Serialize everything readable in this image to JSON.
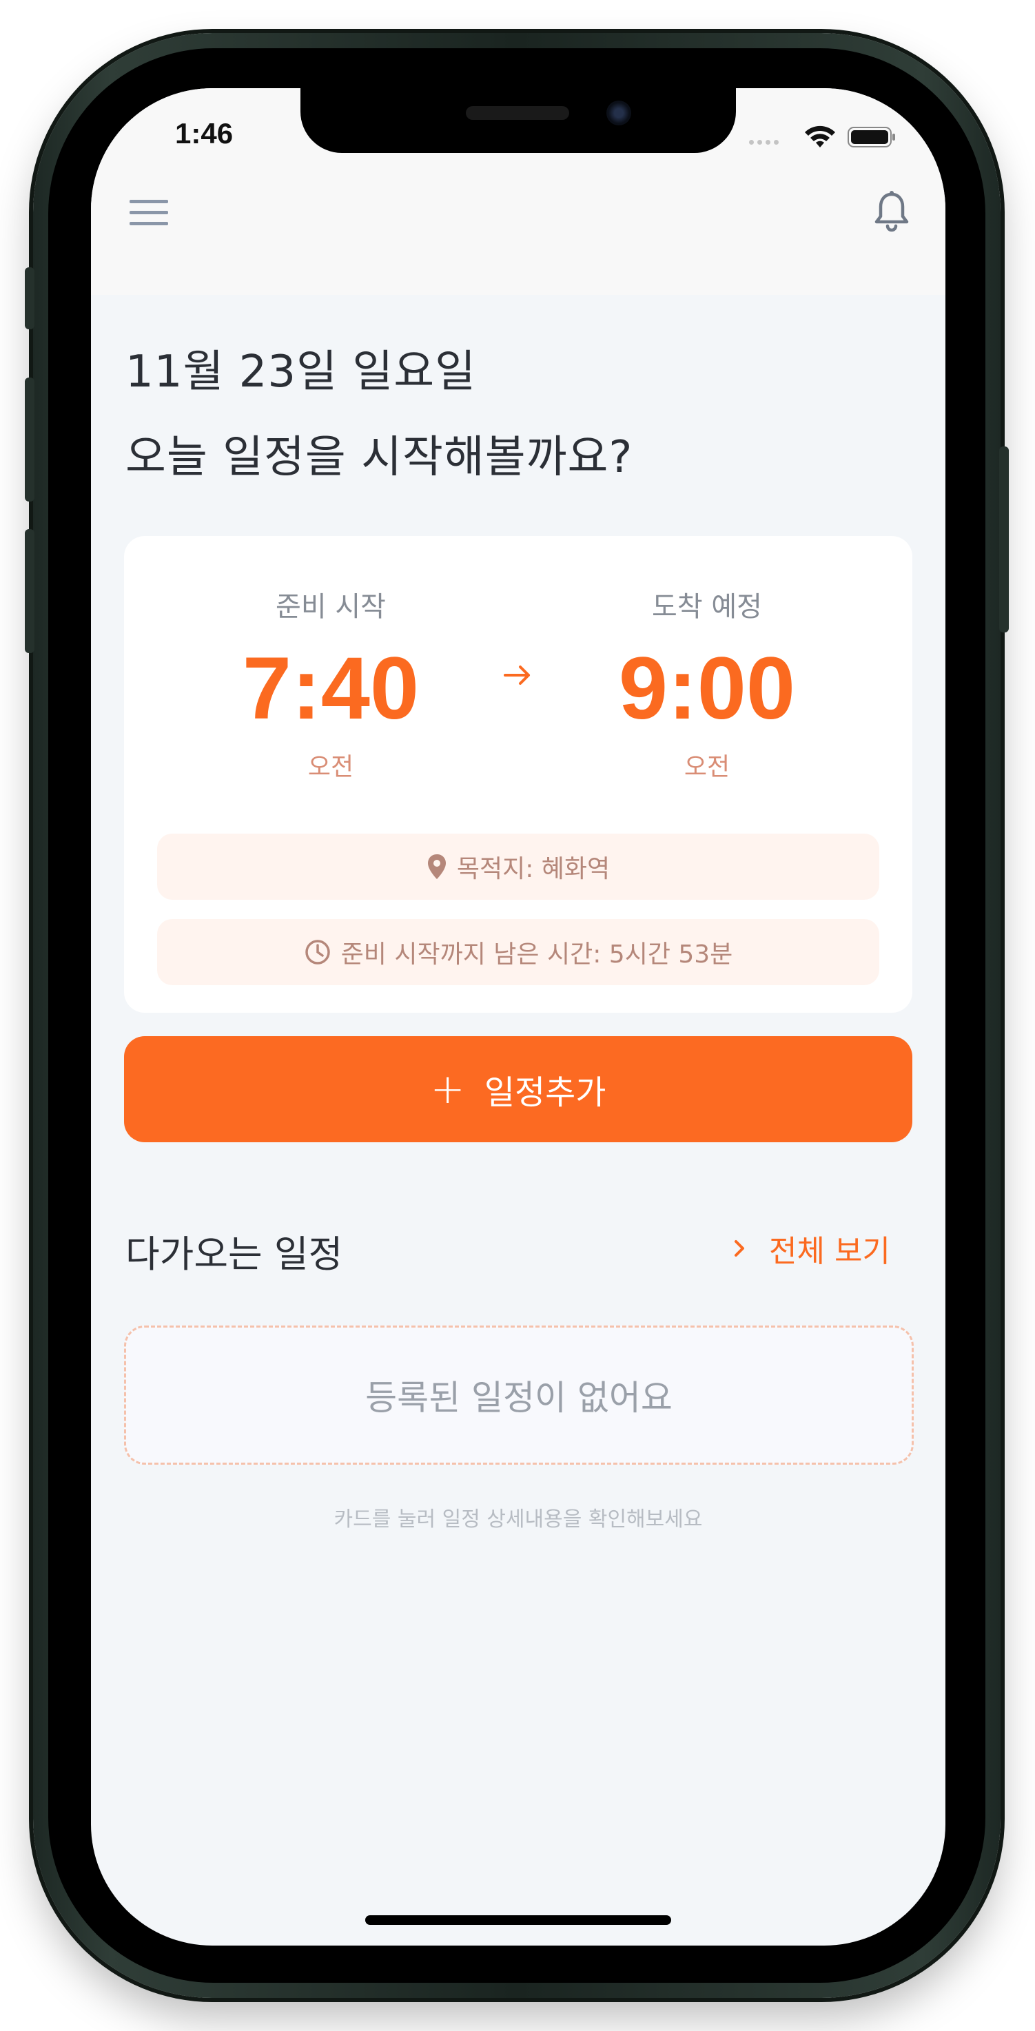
{
  "status_bar": {
    "time": "1:46"
  },
  "header": {
    "menu_icon": "hamburger-menu-icon",
    "notification_icon": "bell-icon"
  },
  "greeting": {
    "date": "11월 23일 일요일",
    "message": "오늘 일정을 시작해볼까요?"
  },
  "schedule_card": {
    "prep_start": {
      "label": "준비 시작",
      "time": "7:40",
      "period": "오전"
    },
    "arrival": {
      "label": "도착 예정",
      "time": "9:00",
      "period": "오전"
    },
    "destination": "목적지: 혜화역",
    "remaining": "준비 시작까지 남은 시간: 5시간 53분"
  },
  "add_button": {
    "label": "일정추가",
    "icon": "plus-icon"
  },
  "upcoming": {
    "title": "다가오는 일정",
    "see_all": "전체 보기",
    "empty_message": "등록된 일정이 없어요",
    "hint": "카드를 눌러 일정 상세내용을 확인해보세요"
  },
  "colors": {
    "accent": "#fc6a22",
    "background": "#f3f6f9",
    "pill_background": "#fff4ef"
  }
}
